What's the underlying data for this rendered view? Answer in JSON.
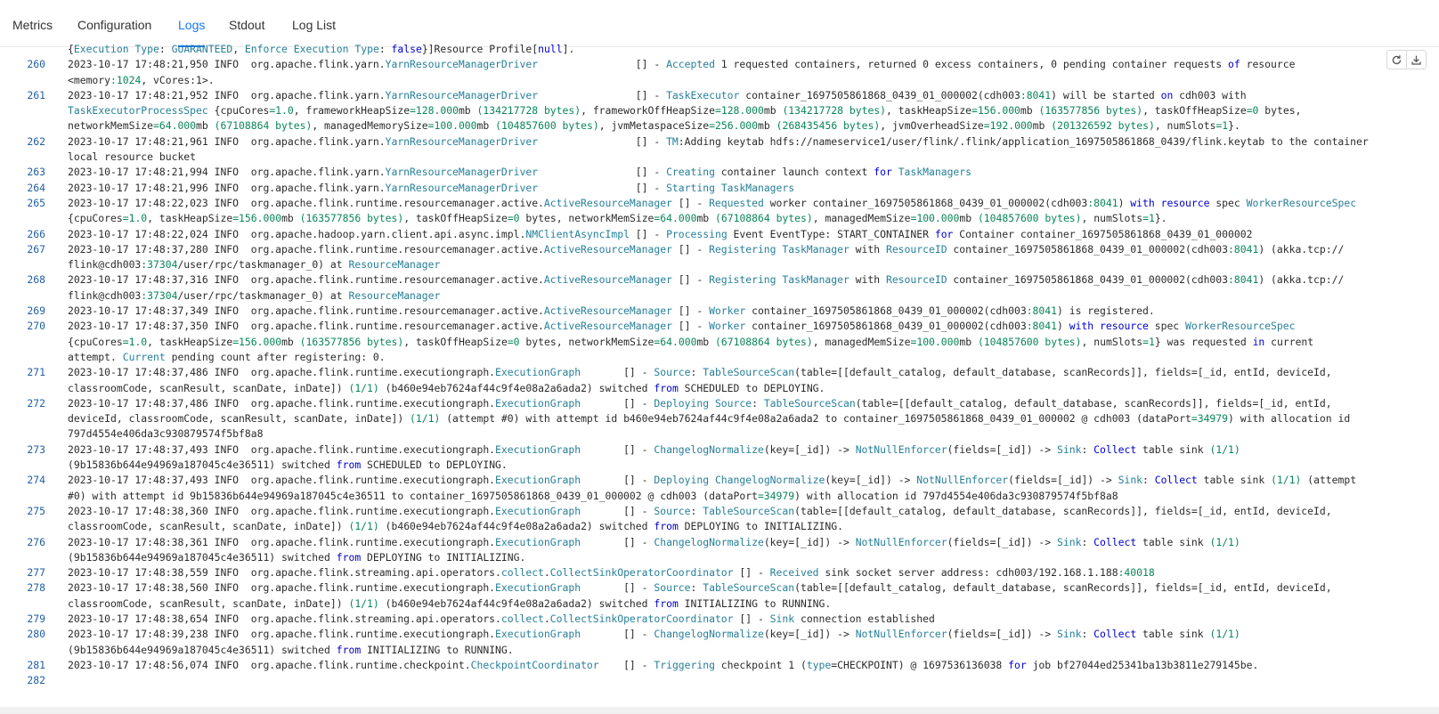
{
  "tabs": [
    {
      "label": "Metrics"
    },
    {
      "label": "Configuration"
    },
    {
      "label": "Logs",
      "active": true
    },
    {
      "label": "Stdout"
    },
    {
      "label": "Log List"
    }
  ],
  "toolbar": {
    "refresh_icon": "refresh-icon",
    "download_icon": "download-icon"
  },
  "colors": {
    "accent": "#1677ff",
    "line_number": "#1f5fa5",
    "class_highlight": "#267f99",
    "keyword": "#0000cc",
    "number": "#098658"
  },
  "log": {
    "prev_tail": "{Execution Type: GUARANTEED, Enforce Execution Type: false}]Resource Profile[null].",
    "lines": [
      {
        "n": "260",
        "t": [
          "2023-10-17 17:48:21,950 INFO  org.apache.flink.yarn.YarnResourceManagerDriver                [] - Accepted 1 requested containers, returned 0 excess containers, 0 pending container requests of resource",
          "<memory:1024, vCores:1>."
        ]
      },
      {
        "n": "261",
        "t": [
          "2023-10-17 17:48:21,952 INFO  org.apache.flink.yarn.YarnResourceManagerDriver                [] - TaskExecutor container_1697505861868_0439_01_000002(cdh003:8041) will be started on cdh003 with",
          "TaskExecutorProcessSpec {cpuCores=1.0, frameworkHeapSize=128.000mb (134217728 bytes), frameworkOffHeapSize=128.000mb (134217728 bytes), taskHeapSize=156.000mb (163577856 bytes), taskOffHeapSize=0 bytes,",
          "networkMemSize=64.000mb (67108864 bytes), managedMemorySize=100.000mb (104857600 bytes), jvmMetaspaceSize=256.000mb (268435456 bytes), jvmOverheadSize=192.000mb (201326592 bytes), numSlots=1}."
        ]
      },
      {
        "n": "262",
        "t": [
          "2023-10-17 17:48:21,961 INFO  org.apache.flink.yarn.YarnResourceManagerDriver                [] - TM:Adding keytab hdfs://nameservice1/user/flink/.flink/application_1697505861868_0439/flink.keytab to the container",
          "local resource bucket"
        ]
      },
      {
        "n": "263",
        "t": [
          "2023-10-17 17:48:21,994 INFO  org.apache.flink.yarn.YarnResourceManagerDriver                [] - Creating container launch context for TaskManagers"
        ]
      },
      {
        "n": "264",
        "t": [
          "2023-10-17 17:48:21,996 INFO  org.apache.flink.yarn.YarnResourceManagerDriver                [] - Starting TaskManagers"
        ]
      },
      {
        "n": "265",
        "t": [
          "2023-10-17 17:48:22,023 INFO  org.apache.flink.runtime.resourcemanager.active.ActiveResourceManager [] - Requested worker container_1697505861868_0439_01_000002(cdh003:8041) with resource spec WorkerResourceSpec",
          "{cpuCores=1.0, taskHeapSize=156.000mb (163577856 bytes), taskOffHeapSize=0 bytes, networkMemSize=64.000mb (67108864 bytes), managedMemSize=100.000mb (104857600 bytes), numSlots=1}."
        ]
      },
      {
        "n": "266",
        "t": [
          "2023-10-17 17:48:22,024 INFO  org.apache.hadoop.yarn.client.api.async.impl.NMClientAsyncImpl [] - Processing Event EventType: START_CONTAINER for Container container_1697505861868_0439_01_000002"
        ]
      },
      {
        "n": "267",
        "t": [
          "2023-10-17 17:48:37,280 INFO  org.apache.flink.runtime.resourcemanager.active.ActiveResourceManager [] - Registering TaskManager with ResourceID container_1697505861868_0439_01_000002(cdh003:8041) (akka.tcp://",
          "flink@cdh003:37304/user/rpc/taskmanager_0) at ResourceManager"
        ]
      },
      {
        "n": "268",
        "t": [
          "2023-10-17 17:48:37,316 INFO  org.apache.flink.runtime.resourcemanager.active.ActiveResourceManager [] - Registering TaskManager with ResourceID container_1697505861868_0439_01_000002(cdh003:8041) (akka.tcp://",
          "flink@cdh003:37304/user/rpc/taskmanager_0) at ResourceManager"
        ]
      },
      {
        "n": "269",
        "t": [
          "2023-10-17 17:48:37,349 INFO  org.apache.flink.runtime.resourcemanager.active.ActiveResourceManager [] - Worker container_1697505861868_0439_01_000002(cdh003:8041) is registered."
        ]
      },
      {
        "n": "270",
        "t": [
          "2023-10-17 17:48:37,350 INFO  org.apache.flink.runtime.resourcemanager.active.ActiveResourceManager [] - Worker container_1697505861868_0439_01_000002(cdh003:8041) with resource spec WorkerResourceSpec",
          "{cpuCores=1.0, taskHeapSize=156.000mb (163577856 bytes), taskOffHeapSize=0 bytes, networkMemSize=64.000mb (67108864 bytes), managedMemSize=100.000mb (104857600 bytes), numSlots=1} was requested in current",
          "attempt. Current pending count after registering: 0."
        ]
      },
      {
        "n": "271",
        "t": [
          "2023-10-17 17:48:37,486 INFO  org.apache.flink.runtime.executiongraph.ExecutionGraph       [] - Source: TableSourceScan(table=[[default_catalog, default_database, scanRecords]], fields=[_id, entId, deviceId,",
          "classroomCode, scanResult, scanDate, inDate]) (1/1) (b460e94eb7624af44c9f4e08a2a6ada2) switched from SCHEDULED to DEPLOYING."
        ]
      },
      {
        "n": "272",
        "t": [
          "2023-10-17 17:48:37,486 INFO  org.apache.flink.runtime.executiongraph.ExecutionGraph       [] - Deploying Source: TableSourceScan(table=[[default_catalog, default_database, scanRecords]], fields=[_id, entId,",
          "deviceId, classroomCode, scanResult, scanDate, inDate]) (1/1) (attempt #0) with attempt id b460e94eb7624af44c9f4e08a2a6ada2 to container_1697505861868_0439_01_000002 @ cdh003 (dataPort=34979) with allocation id",
          "797d4554e406da3c930879574f5bf8a8"
        ]
      },
      {
        "n": "273",
        "t": [
          "2023-10-17 17:48:37,493 INFO  org.apache.flink.runtime.executiongraph.ExecutionGraph       [] - ChangelogNormalize(key=[_id]) -> NotNullEnforcer(fields=[_id]) -> Sink: Collect table sink (1/1)",
          "(9b15836b644e94969a187045c4e36511) switched from SCHEDULED to DEPLOYING."
        ]
      },
      {
        "n": "274",
        "t": [
          "2023-10-17 17:48:37,493 INFO  org.apache.flink.runtime.executiongraph.ExecutionGraph       [] - Deploying ChangelogNormalize(key=[_id]) -> NotNullEnforcer(fields=[_id]) -> Sink: Collect table sink (1/1) (attempt",
          "#0) with attempt id 9b15836b644e94969a187045c4e36511 to container_1697505861868_0439_01_000002 @ cdh003 (dataPort=34979) with allocation id 797d4554e406da3c930879574f5bf8a8"
        ]
      },
      {
        "n": "275",
        "t": [
          "2023-10-17 17:48:38,360 INFO  org.apache.flink.runtime.executiongraph.ExecutionGraph       [] - Source: TableSourceScan(table=[[default_catalog, default_database, scanRecords]], fields=[_id, entId, deviceId,",
          "classroomCode, scanResult, scanDate, inDate]) (1/1) (b460e94eb7624af44c9f4e08a2a6ada2) switched from DEPLOYING to INITIALIZING."
        ]
      },
      {
        "n": "276",
        "t": [
          "2023-10-17 17:48:38,361 INFO  org.apache.flink.runtime.executiongraph.ExecutionGraph       [] - ChangelogNormalize(key=[_id]) -> NotNullEnforcer(fields=[_id]) -> Sink: Collect table sink (1/1)",
          "(9b15836b644e94969a187045c4e36511) switched from DEPLOYING to INITIALIZING."
        ]
      },
      {
        "n": "277",
        "t": [
          "2023-10-17 17:48:38,559 INFO  org.apache.flink.streaming.api.operators.collect.CollectSinkOperatorCoordinator [] - Received sink socket server address: cdh003/192.168.1.188:40018"
        ]
      },
      {
        "n": "278",
        "t": [
          "2023-10-17 17:48:38,560 INFO  org.apache.flink.runtime.executiongraph.ExecutionGraph       [] - Source: TableSourceScan(table=[[default_catalog, default_database, scanRecords]], fields=[_id, entId, deviceId,",
          "classroomCode, scanResult, scanDate, inDate]) (1/1) (b460e94eb7624af44c9f4e08a2a6ada2) switched from INITIALIZING to RUNNING."
        ]
      },
      {
        "n": "279",
        "t": [
          "2023-10-17 17:48:38,654 INFO  org.apache.flink.streaming.api.operators.collect.CollectSinkOperatorCoordinator [] - Sink connection established"
        ]
      },
      {
        "n": "280",
        "t": [
          "2023-10-17 17:48:39,238 INFO  org.apache.flink.runtime.executiongraph.ExecutionGraph       [] - ChangelogNormalize(key=[_id]) -> NotNullEnforcer(fields=[_id]) -> Sink: Collect table sink (1/1)",
          "(9b15836b644e94969a187045c4e36511) switched from INITIALIZING to RUNNING."
        ]
      },
      {
        "n": "281",
        "t": [
          "2023-10-17 17:48:56,074 INFO  org.apache.flink.runtime.checkpoint.CheckpointCoordinator    [] - Triggering checkpoint 1 (type=CHECKPOINT) @ 1697536136038 for job bf27044ed25341ba13b3811e279145be."
        ]
      },
      {
        "n": "282",
        "t": [
          ""
        ]
      }
    ]
  }
}
